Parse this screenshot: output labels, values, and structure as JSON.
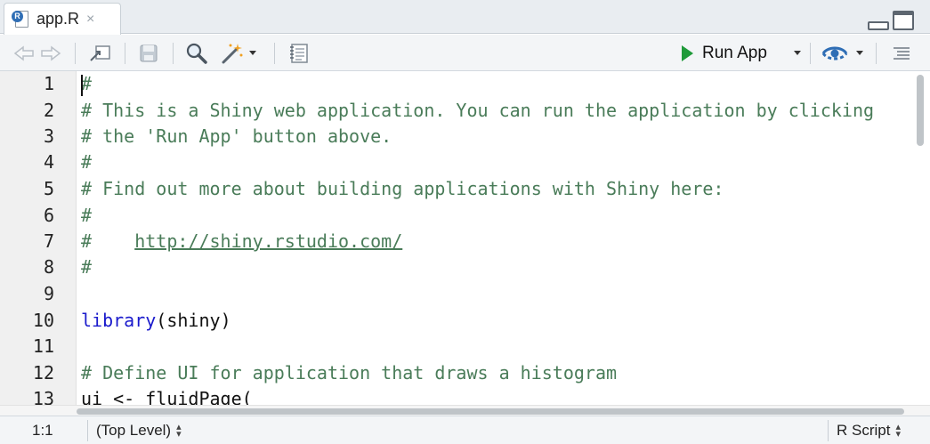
{
  "tab": {
    "title": "app.R",
    "close": "×",
    "icon_badge": "R"
  },
  "toolbar": {
    "run_app_label": "Run App",
    "icons": [
      "back-arrow-icon",
      "forward-arrow-icon",
      "show-in-window-icon",
      "save-icon",
      "search-icon",
      "magic-wand-icon",
      "notebook-icon",
      "publish-icon",
      "outline-icon"
    ]
  },
  "editor": {
    "line_numbers": [
      "1",
      "2",
      "3",
      "4",
      "5",
      "6",
      "7",
      "8",
      "9",
      "10",
      "11",
      "12",
      "13"
    ],
    "lines": [
      {
        "type": "comment",
        "text": "#"
      },
      {
        "type": "comment",
        "text": "# This is a Shiny web application. You can run the application by clicking"
      },
      {
        "type": "comment",
        "text": "# the 'Run App' button above."
      },
      {
        "type": "comment",
        "text": "#"
      },
      {
        "type": "comment",
        "text": "# Find out more about building applications with Shiny here:"
      },
      {
        "type": "comment",
        "text": "#"
      },
      {
        "type": "comment_link",
        "prefix": "#    ",
        "link": "http://shiny.rstudio.com/"
      },
      {
        "type": "comment",
        "text": "#"
      },
      {
        "type": "blank",
        "text": ""
      },
      {
        "type": "call",
        "fn": "library",
        "open": "(",
        "arg": "shiny",
        "close": ")"
      },
      {
        "type": "blank",
        "text": ""
      },
      {
        "type": "comment",
        "text": "# Define UI for application that draws a histogram"
      },
      {
        "type": "plain",
        "text": "ui <- fluidPage("
      }
    ]
  },
  "status": {
    "position": "1:1",
    "scope": "(Top Level)",
    "file_type": "R Script"
  },
  "colors": {
    "comment": "#4a7c59",
    "keyword": "#1a1acc",
    "run_green": "#1f9a3a",
    "publish_blue": "#2f6eb5"
  }
}
